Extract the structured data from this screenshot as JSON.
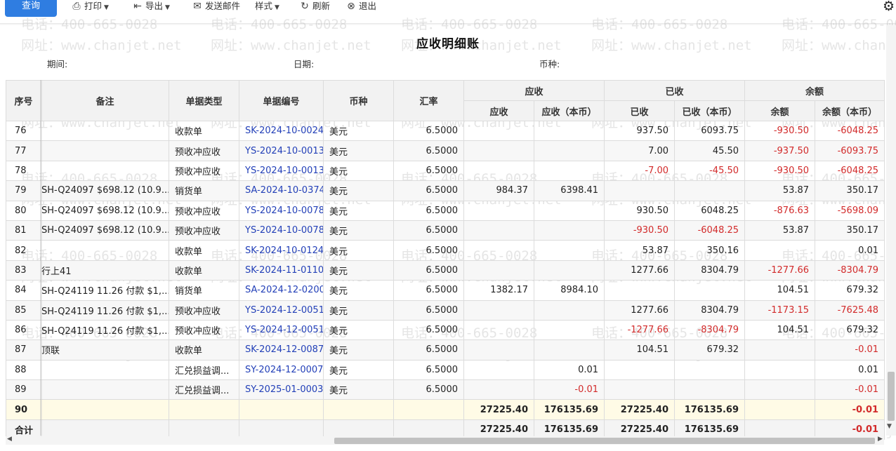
{
  "toolbar": {
    "query": "查询",
    "print": "打印",
    "export": "导出",
    "send_mail": "发送邮件",
    "style": "样式",
    "refresh": "刷新",
    "exit": "退出"
  },
  "report": {
    "title": "应收明细账",
    "period_label": "期间:",
    "date_label": "日期:",
    "currency_label": "币种:"
  },
  "headers": {
    "seq": "序号",
    "remark": "备注",
    "doc_type": "单据类型",
    "doc_no": "单据编号",
    "currency": "币种",
    "rate": "汇率",
    "receivable": "应收",
    "receivable_amt": "应收",
    "receivable_local": "应收（本币）",
    "received": "已收",
    "received_amt": "已收",
    "received_local": "已收（本币）",
    "balance": "余额",
    "balance_amt": "余额",
    "balance_local": "余额（本币）"
  },
  "rows": [
    {
      "seq": "76",
      "remark": "",
      "type": "收款单",
      "no": "SK-2024-10-0024",
      "cur": "美元",
      "rate": "6.5000",
      "ar": "",
      "ar_l": "",
      "rc": "937.50",
      "rc_l": "6093.75",
      "bal": "-930.50",
      "bal_l": "-6048.25"
    },
    {
      "seq": "77",
      "remark": "",
      "type": "预收冲应收",
      "no": "YS-2024-10-0013",
      "cur": "美元",
      "rate": "6.5000",
      "ar": "",
      "ar_l": "",
      "rc": "7.00",
      "rc_l": "45.50",
      "bal": "-937.50",
      "bal_l": "-6093.75"
    },
    {
      "seq": "78",
      "remark": "",
      "type": "预收冲应收",
      "no": "YS-2024-10-0013",
      "cur": "美元",
      "rate": "6.5000",
      "ar": "",
      "ar_l": "",
      "rc": "-7.00",
      "rc_l": "-45.50",
      "bal": "-930.50",
      "bal_l": "-6048.25"
    },
    {
      "seq": "79",
      "remark": "SH-Q24097 $698.12 (10.9...",
      "type": "销货单",
      "no": "SA-2024-10-0374",
      "cur": "美元",
      "rate": "6.5000",
      "ar": "984.37",
      "ar_l": "6398.41",
      "rc": "",
      "rc_l": "",
      "bal": "53.87",
      "bal_l": "350.17"
    },
    {
      "seq": "80",
      "remark": "SH-Q24097 $698.12 (10.9...",
      "type": "预收冲应收",
      "no": "YS-2024-10-0078",
      "cur": "美元",
      "rate": "6.5000",
      "ar": "",
      "ar_l": "",
      "rc": "930.50",
      "rc_l": "6048.25",
      "bal": "-876.63",
      "bal_l": "-5698.09"
    },
    {
      "seq": "81",
      "remark": "SH-Q24097 $698.12 (10.9...",
      "type": "预收冲应收",
      "no": "YS-2024-10-0078",
      "cur": "美元",
      "rate": "6.5000",
      "ar": "",
      "ar_l": "",
      "rc": "-930.50",
      "rc_l": "-6048.25",
      "bal": "53.87",
      "bal_l": "350.17"
    },
    {
      "seq": "82",
      "remark": "",
      "type": "收款单",
      "no": "SK-2024-10-0124",
      "cur": "美元",
      "rate": "6.5000",
      "ar": "",
      "ar_l": "",
      "rc": "53.87",
      "rc_l": "350.16",
      "bal": "",
      "bal_l": "0.01"
    },
    {
      "seq": "83",
      "remark": "行上41",
      "type": "收款单",
      "no": "SK-2024-11-0110",
      "cur": "美元",
      "rate": "6.5000",
      "ar": "",
      "ar_l": "",
      "rc": "1277.66",
      "rc_l": "8304.79",
      "bal": "-1277.66",
      "bal_l": "-8304.79"
    },
    {
      "seq": "84",
      "remark": "SH-Q24119 11.26 付款 $1,...",
      "type": "销货单",
      "no": "SA-2024-12-0200",
      "cur": "美元",
      "rate": "6.5000",
      "ar": "1382.17",
      "ar_l": "8984.10",
      "rc": "",
      "rc_l": "",
      "bal": "104.51",
      "bal_l": "679.32"
    },
    {
      "seq": "85",
      "remark": "SH-Q24119 11.26 付款 $1,...",
      "type": "预收冲应收",
      "no": "YS-2024-12-0051",
      "cur": "美元",
      "rate": "6.5000",
      "ar": "",
      "ar_l": "",
      "rc": "1277.66",
      "rc_l": "8304.79",
      "bal": "-1173.15",
      "bal_l": "-7625.48"
    },
    {
      "seq": "86",
      "remark": "SH-Q24119 11.26 付款 $1,...",
      "type": "预收冲应收",
      "no": "YS-2024-12-0051",
      "cur": "美元",
      "rate": "6.5000",
      "ar": "",
      "ar_l": "",
      "rc": "-1277.66",
      "rc_l": "-8304.79",
      "bal": "104.51",
      "bal_l": "679.32"
    },
    {
      "seq": "87",
      "remark": "顶联",
      "type": "收款单",
      "no": "SK-2024-12-0087",
      "cur": "美元",
      "rate": "6.5000",
      "ar": "",
      "ar_l": "",
      "rc": "104.51",
      "rc_l": "679.32",
      "bal": "",
      "bal_l": "-0.01"
    },
    {
      "seq": "88",
      "remark": "",
      "type": "汇兑损益调...",
      "no": "SY-2024-12-0007",
      "cur": "美元",
      "rate": "6.5000",
      "ar": "",
      "ar_l": "0.01",
      "rc": "",
      "rc_l": "",
      "bal": "",
      "bal_l": "0.01"
    },
    {
      "seq": "89",
      "remark": "",
      "type": "汇兑损益调...",
      "no": "SY-2025-01-0003",
      "cur": "美元",
      "rate": "6.5000",
      "ar": "",
      "ar_l": "-0.01",
      "rc": "",
      "rc_l": "",
      "bal": "",
      "bal_l": "-0.01"
    }
  ],
  "subtotal_row": {
    "seq": "90",
    "ar": "27225.40",
    "ar_l": "176135.69",
    "rc": "27225.40",
    "rc_l": "176135.69",
    "bal_l": "-0.01"
  },
  "total_row": {
    "label": "合计",
    "ar": "27225.40",
    "ar_l": "176135.69",
    "rc": "27225.40",
    "rc_l": "176135.69",
    "bal_l": "-0.01"
  },
  "watermark": {
    "phone": "电话：400-665-0028",
    "site": "网址：www.chanjet.net"
  },
  "colors": {
    "accent": "#2f7de1",
    "doc_link": "#2340b8",
    "negative": "#d22a2a",
    "selected_row": "#fffbe6"
  },
  "icons": {
    "print": "printer-icon",
    "export": "export-icon",
    "mail": "mail-icon",
    "refresh": "refresh-icon",
    "exit": "exit-icon",
    "settings": "gear-icon"
  }
}
